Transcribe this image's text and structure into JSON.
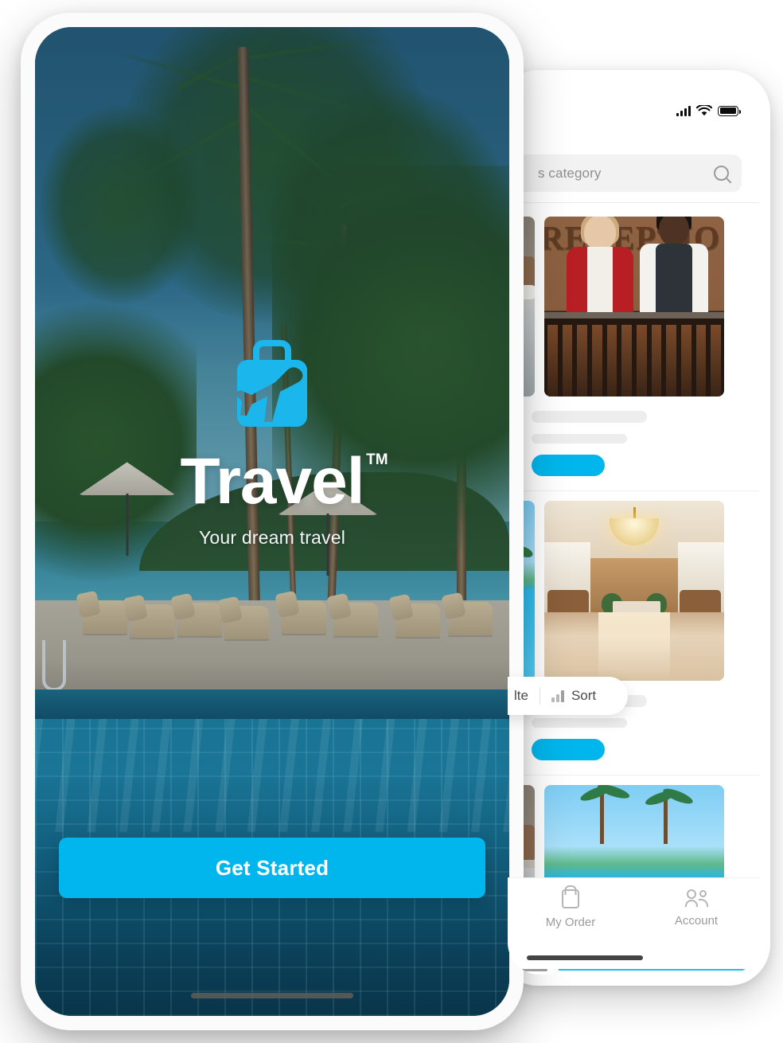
{
  "theme": {
    "accent": "#00b6ec",
    "screen_bg": "#ffffff",
    "muted_text": "#9b9b9b"
  },
  "left_phone": {
    "name": "onboarding-splash",
    "brand": {
      "logo_icon": "suitcase-airplane-logo",
      "wordmark": "Travel",
      "trademark": "TM",
      "tagline": "Your dream travel"
    },
    "cta": {
      "label": "Get Started"
    },
    "background_scene": "poolside-resort-palm-trees-ocean"
  },
  "right_phone": {
    "name": "hotel-listing-screen",
    "status_bar": {
      "cellular_icon": "signal-bars-icon",
      "wifi_icon": "wifi-icon",
      "battery_icon": "battery-full-icon"
    },
    "search": {
      "placeholder": "s category",
      "search_icon": "search-icon"
    },
    "cards": [
      {
        "side_image": "hotel-room-thumbnail",
        "main_image": "hotel-reception-desk-photo",
        "reception_sign": "RECEPTIO",
        "title_placeholder": "",
        "subtitle_placeholder": "",
        "cta_placeholder": ""
      },
      {
        "side_image": "resort-pool-thumbnail",
        "main_image": "hotel-lobby-chandelier-photo",
        "title_placeholder": "",
        "subtitle_placeholder": "",
        "cta_placeholder": ""
      }
    ],
    "filter_sort_bar": {
      "filter_label": "lte",
      "sort_label": "Sort",
      "sort_icon": "bar-chart-icon"
    },
    "tab_bar": {
      "tabs": [
        {
          "label": "My Order",
          "icon": "shopping-bag-icon"
        },
        {
          "label": "Account",
          "icon": "people-icon"
        }
      ]
    }
  }
}
